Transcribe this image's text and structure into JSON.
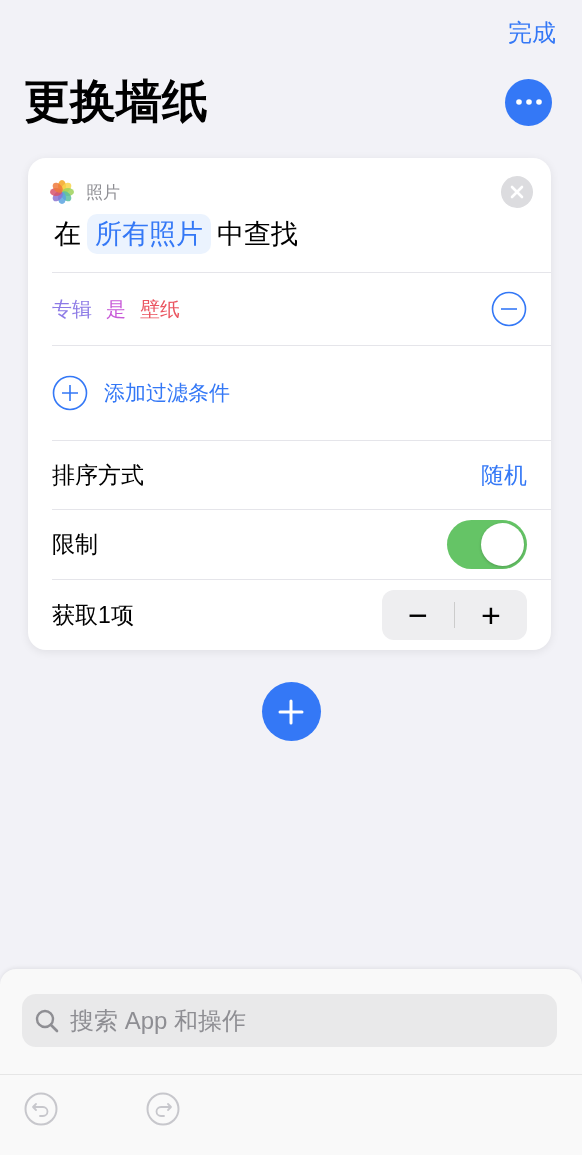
{
  "nav": {
    "done": "完成"
  },
  "title": "更换墙纸",
  "action": {
    "app": "照片",
    "prefix": "在",
    "source": "所有照片",
    "suffix": "中查找",
    "filter": [
      {
        "text": "专辑",
        "color": "#8c7ae6"
      },
      {
        "text": "是",
        "color": "#c85ad8"
      },
      {
        "text": "壁纸",
        "color": "#ea5560"
      }
    ],
    "add_filter": "添加过滤条件",
    "rows": [
      {
        "kind": "value",
        "label": "排序方式",
        "value": "随机"
      },
      {
        "kind": "toggle",
        "label": "限制",
        "on": true
      },
      {
        "kind": "stepper",
        "label": "获取1项",
        "minus": "−",
        "plus": "+"
      }
    ]
  },
  "search": {
    "placeholder": "搜索 App 和操作"
  },
  "toolbar": [
    {
      "kind": "undo",
      "disabled": true
    },
    {
      "kind": "redo",
      "disabled": true
    }
  ]
}
